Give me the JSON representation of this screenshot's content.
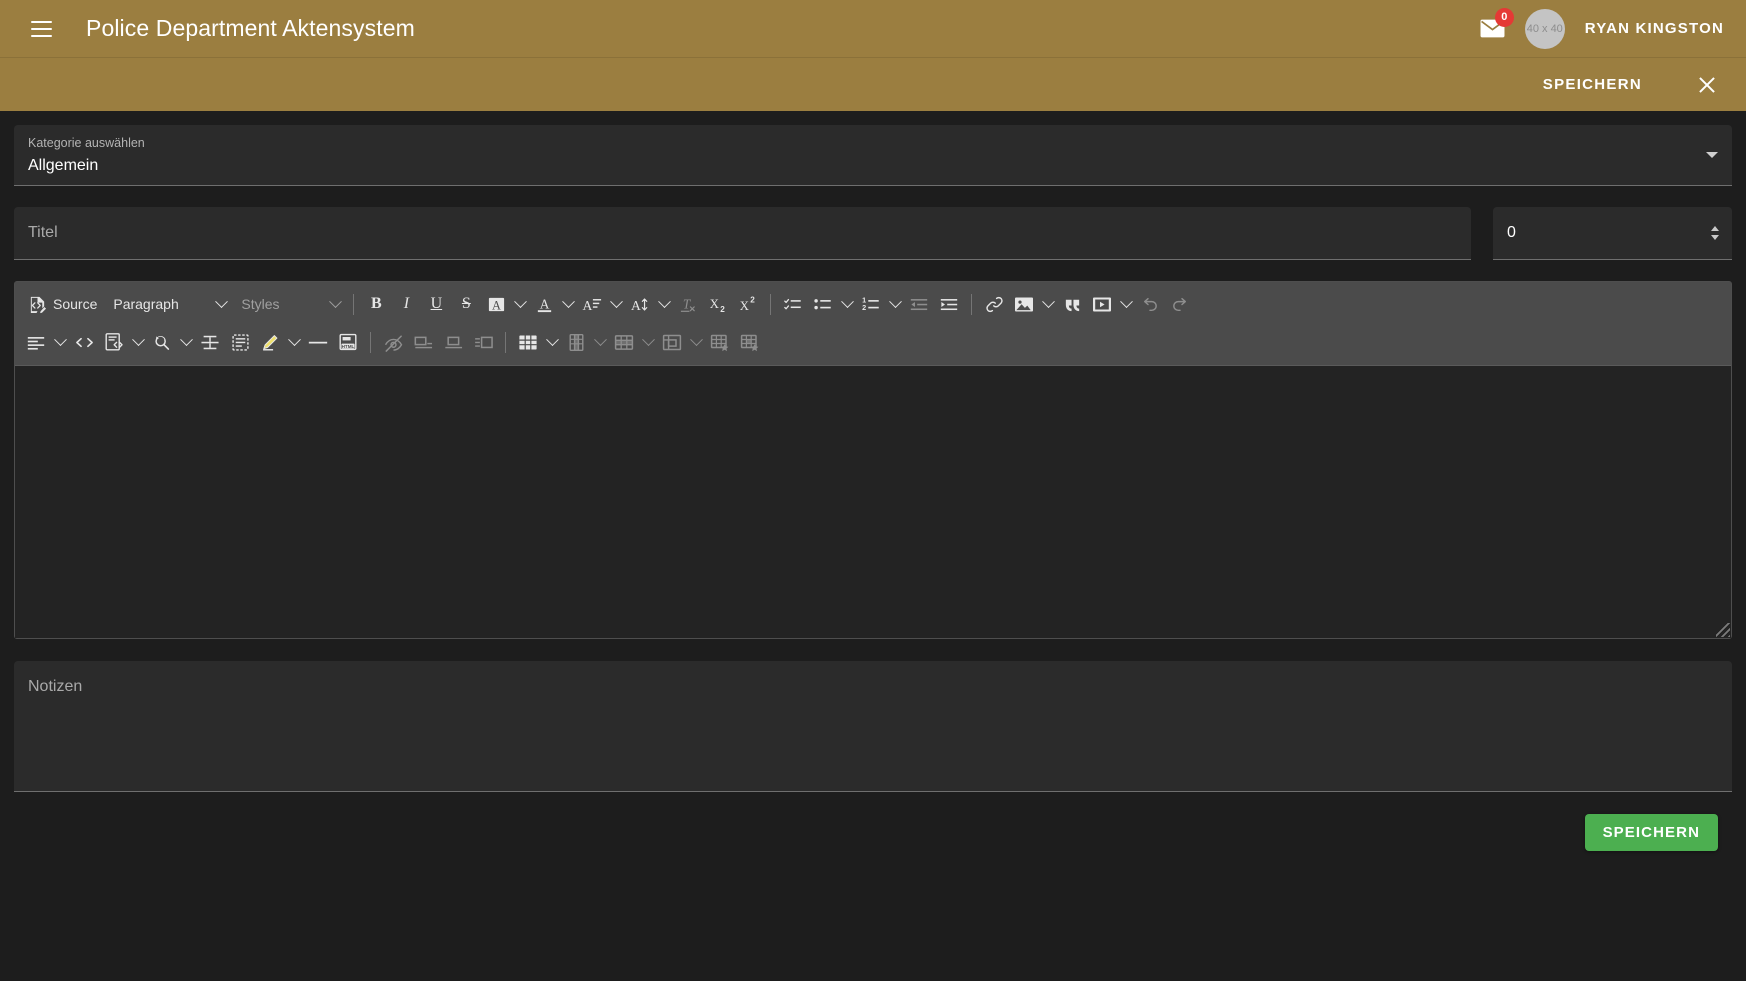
{
  "appbar": {
    "menu_icon": "hamburger-menu-icon",
    "title": "Police Department Aktensystem",
    "mail_icon": "mail-envelope-icon",
    "mail_badge": "0",
    "avatar_text": "40 x 40",
    "username": "RYAN KINGSTON",
    "background_color": "#9b7e40"
  },
  "subbar": {
    "save_label": "SPEICHERN",
    "close_icon": "close-x-icon"
  },
  "form": {
    "category": {
      "label": "Kategorie auswählen",
      "value": "Allgemein",
      "caret_icon": "chevron-down-icon"
    },
    "title": {
      "placeholder": "Titel",
      "value": ""
    },
    "number": {
      "value": "0",
      "spinner_icon": "stepper-up-down-icon"
    },
    "notes": {
      "placeholder": "Notizen",
      "value": ""
    }
  },
  "editor": {
    "content": "",
    "toolbar_row1": [
      {
        "name": "source-button",
        "label": "Source",
        "icon": "source-code-icon",
        "type": "icon-text",
        "disabled": false
      },
      {
        "name": "paragraph-format-dropdown",
        "label": "Paragraph",
        "type": "dropdown",
        "width": "para",
        "disabled": false
      },
      {
        "name": "styles-dropdown",
        "label": "Styles",
        "type": "dropdown",
        "width": "styles",
        "disabled": true
      },
      {
        "name": "separator-1",
        "type": "separator"
      },
      {
        "name": "bold-button",
        "icon": "bold-icon",
        "type": "icon",
        "disabled": false
      },
      {
        "name": "italic-button",
        "icon": "italic-icon",
        "type": "icon",
        "disabled": false
      },
      {
        "name": "underline-button",
        "icon": "underline-icon",
        "type": "icon",
        "disabled": false
      },
      {
        "name": "strikethrough-button",
        "icon": "strikethrough-icon",
        "type": "icon",
        "disabled": false
      },
      {
        "name": "font-background-color-button",
        "icon": "font-background-color-icon",
        "type": "icon-chevron",
        "disabled": false
      },
      {
        "name": "font-color-button",
        "icon": "font-color-icon",
        "type": "icon-chevron",
        "disabled": false
      },
      {
        "name": "font-family-button",
        "icon": "font-family-icon",
        "type": "icon-chevron",
        "disabled": false
      },
      {
        "name": "font-size-button",
        "icon": "font-size-icon",
        "type": "icon-chevron",
        "disabled": false
      },
      {
        "name": "remove-format-button",
        "icon": "remove-format-icon",
        "type": "icon",
        "disabled": true
      },
      {
        "name": "subscript-button",
        "icon": "subscript-icon",
        "type": "icon",
        "disabled": false
      },
      {
        "name": "superscript-button",
        "icon": "superscript-icon",
        "type": "icon",
        "disabled": false
      },
      {
        "name": "separator-2",
        "type": "separator"
      },
      {
        "name": "todo-list-button",
        "icon": "todo-list-icon",
        "type": "icon",
        "disabled": false
      },
      {
        "name": "bulleted-list-button",
        "icon": "bulleted-list-icon",
        "type": "icon-chevron",
        "disabled": false
      },
      {
        "name": "numbered-list-button",
        "icon": "numbered-list-icon",
        "type": "icon-chevron",
        "disabled": false
      },
      {
        "name": "decrease-indent-button",
        "icon": "outdent-icon",
        "type": "icon",
        "disabled": true
      },
      {
        "name": "increase-indent-button",
        "icon": "indent-icon",
        "type": "icon",
        "disabled": false
      },
      {
        "name": "separator-3",
        "type": "separator"
      },
      {
        "name": "link-button",
        "icon": "link-icon",
        "type": "icon",
        "disabled": false
      },
      {
        "name": "insert-image-button",
        "icon": "image-icon",
        "type": "icon-chevron",
        "disabled": false
      },
      {
        "name": "block-quote-button",
        "icon": "block-quote-icon",
        "type": "icon",
        "disabled": false
      },
      {
        "name": "insert-media-button",
        "icon": "media-icon",
        "type": "icon-chevron",
        "disabled": false
      },
      {
        "name": "undo-button",
        "icon": "undo-icon",
        "type": "icon",
        "disabled": true
      },
      {
        "name": "redo-button",
        "icon": "redo-icon",
        "type": "icon",
        "disabled": true
      }
    ],
    "toolbar_row2": [
      {
        "name": "text-alignment-button",
        "icon": "align-left-icon",
        "type": "icon-chevron",
        "disabled": false
      },
      {
        "name": "inline-code-button",
        "icon": "code-icon",
        "type": "icon",
        "disabled": false
      },
      {
        "name": "code-block-button",
        "icon": "code-block-icon",
        "type": "icon-chevron",
        "disabled": false
      },
      {
        "name": "find-and-replace-button",
        "icon": "find-replace-icon",
        "type": "icon-chevron",
        "disabled": false
      },
      {
        "name": "page-break-button",
        "icon": "page-break-icon",
        "type": "icon",
        "disabled": false
      },
      {
        "name": "insert-template-button",
        "icon": "template-icon",
        "type": "icon",
        "disabled": false
      },
      {
        "name": "highlight-marker-button",
        "icon": "marker-pen-icon",
        "type": "icon-chevron",
        "disabled": false
      },
      {
        "name": "horizontal-line-button",
        "icon": "horizontal-line-icon",
        "type": "icon",
        "disabled": false
      },
      {
        "name": "html-embed-button",
        "icon": "html-embed-icon",
        "type": "icon",
        "disabled": false
      },
      {
        "name": "separator-4",
        "type": "separator"
      },
      {
        "name": "toggle-image-caption-button",
        "icon": "image-caption-off-icon",
        "type": "icon",
        "disabled": true
      },
      {
        "name": "image-align-left-button",
        "icon": "image-align-left-icon",
        "type": "icon",
        "disabled": true
      },
      {
        "name": "image-align-center-button",
        "icon": "image-align-center-icon",
        "type": "icon",
        "disabled": true
      },
      {
        "name": "image-text-wrap-button",
        "icon": "image-text-wrap-icon",
        "type": "icon",
        "disabled": true
      },
      {
        "name": "separator-5",
        "type": "separator"
      },
      {
        "name": "insert-table-button",
        "icon": "insert-table-icon",
        "type": "icon-chevron",
        "disabled": false
      },
      {
        "name": "table-column-button",
        "icon": "table-column-icon",
        "type": "icon-chevron",
        "disabled": true
      },
      {
        "name": "table-row-button",
        "icon": "table-row-icon",
        "type": "icon-chevron",
        "disabled": true
      },
      {
        "name": "merge-cells-button",
        "icon": "merge-cells-icon",
        "type": "icon-chevron",
        "disabled": true
      },
      {
        "name": "table-properties-button",
        "icon": "table-properties-icon",
        "type": "icon",
        "disabled": true
      },
      {
        "name": "table-cell-properties-button",
        "icon": "table-cell-properties-icon",
        "type": "icon",
        "disabled": true
      }
    ],
    "resize_handle": "resize-grip-icon"
  },
  "footer": {
    "save_label": "SPEICHERN",
    "save_color": "#4caf50"
  }
}
